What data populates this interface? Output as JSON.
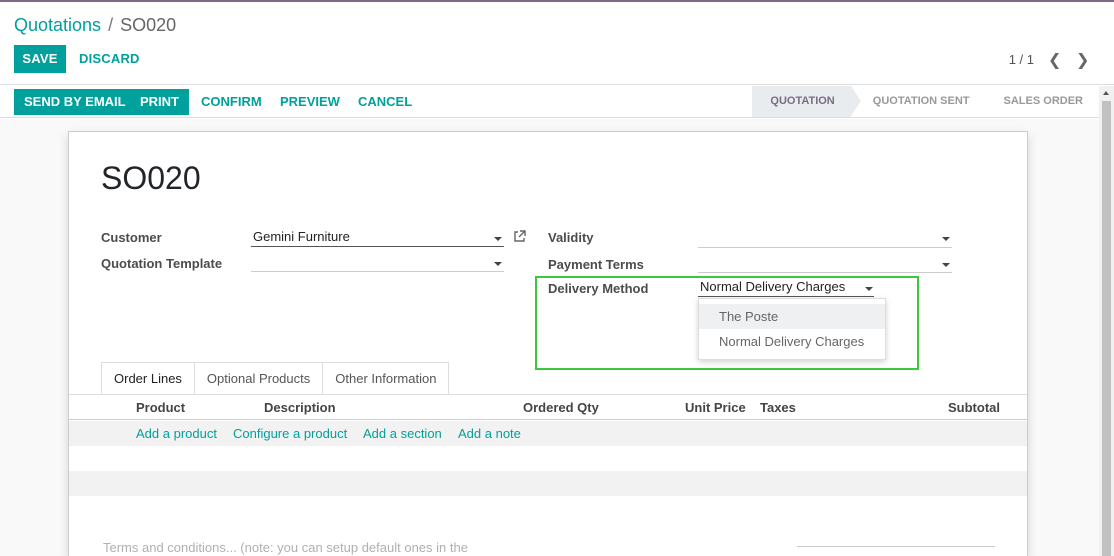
{
  "breadcrumb": {
    "parent": "Quotations",
    "separator": "/",
    "current": "SO020"
  },
  "actions": {
    "save": "SAVE",
    "discard": "DISCARD"
  },
  "pager": {
    "value": "1 / 1",
    "prev_icon": "chevron-left-icon",
    "next_icon": "chevron-right-icon"
  },
  "statusbar": {
    "buttons": [
      "SEND BY EMAIL",
      "PRINT",
      "CONFIRM",
      "PREVIEW",
      "CANCEL"
    ],
    "stages": [
      "QUOTATION",
      "QUOTATION SENT",
      "SALES ORDER"
    ],
    "active_stage": "QUOTATION"
  },
  "form": {
    "title": "SO020",
    "customer": {
      "label": "Customer",
      "value": "Gemini Furniture"
    },
    "quotation_template": {
      "label": "Quotation Template",
      "value": ""
    },
    "validity": {
      "label": "Validity",
      "value": ""
    },
    "payment_terms": {
      "label": "Payment Terms",
      "value": ""
    },
    "delivery_method": {
      "label": "Delivery Method",
      "value": "Normal Delivery Charges",
      "options": [
        "The Poste",
        "Normal Delivery Charges"
      ],
      "hovered_option": "The Poste"
    }
  },
  "tabs": [
    "Order Lines",
    "Optional Products",
    "Other Information"
  ],
  "active_tab": "Order Lines",
  "table": {
    "columns": [
      "Product",
      "Description",
      "Ordered Qty",
      "Unit Price",
      "Taxes",
      "Subtotal"
    ],
    "add_links": [
      "Add a product",
      "Configure a product",
      "Add a section",
      "Add a note"
    ]
  },
  "terms_placeholder": "Terms and conditions... (note: you can setup default ones in the",
  "colors": {
    "accent": "#00a09d",
    "brand": "#7c6a87",
    "highlight_box": "#3cc83c"
  }
}
